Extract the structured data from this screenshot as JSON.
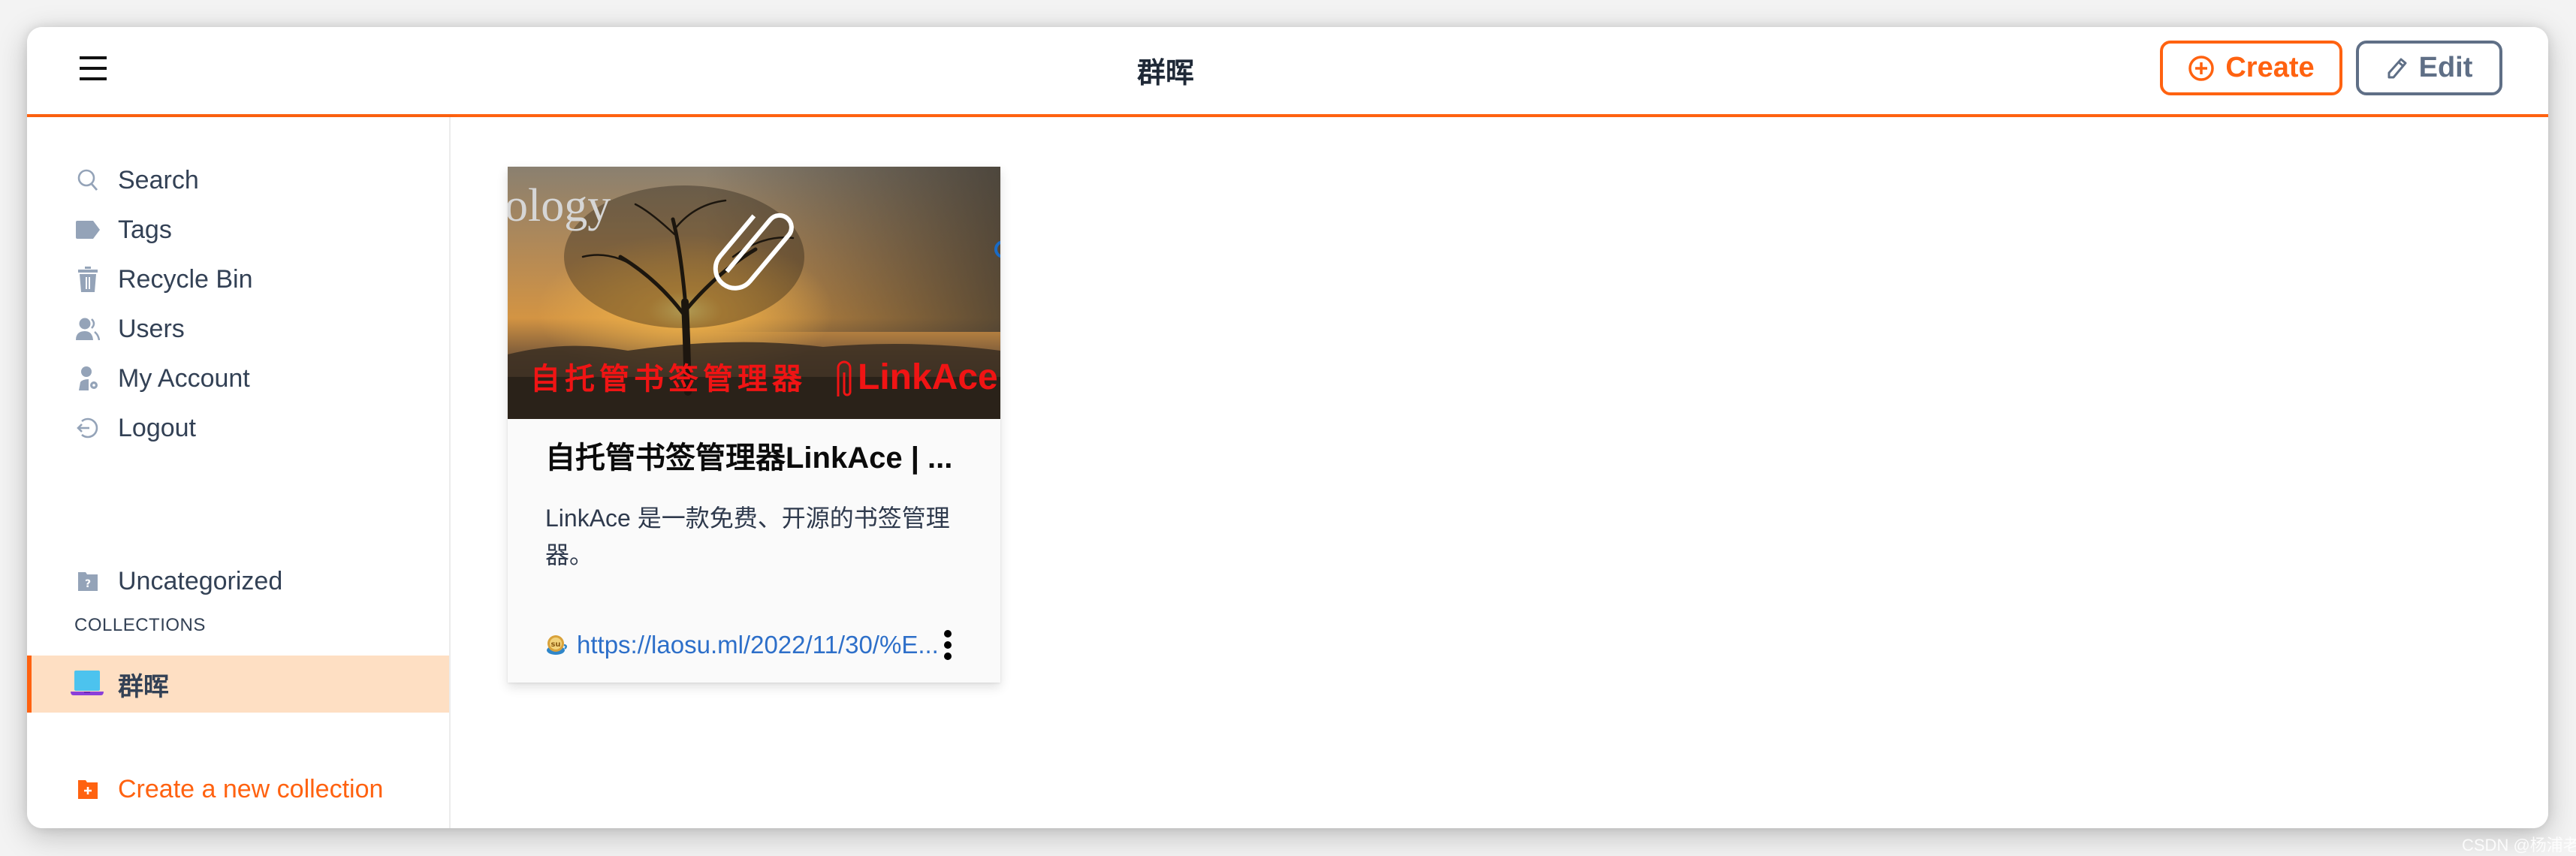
{
  "header": {
    "title": "群晖",
    "menu_icon": "hamburger-menu-icon",
    "create_label": "Create",
    "create_icon": "plus-circle-icon",
    "edit_label": "Edit",
    "edit_icon": "pencil-icon"
  },
  "sidebar": {
    "items": [
      {
        "label": "Search",
        "icon": "search-icon"
      },
      {
        "label": "Tags",
        "icon": "tag-icon"
      },
      {
        "label": "Recycle Bin",
        "icon": "trash-icon"
      },
      {
        "label": "Users",
        "icon": "users-icon"
      },
      {
        "label": "My Account",
        "icon": "user-gear-icon"
      },
      {
        "label": "Logout",
        "icon": "logout-icon"
      }
    ],
    "uncategorized": {
      "label": "Uncategorized",
      "icon": "folder-question-icon"
    },
    "collections_heading": "COLLECTIONS",
    "collections": [
      {
        "label": "群晖",
        "icon": "laptop-icon",
        "active": true
      }
    ],
    "create_collection": {
      "label": "Create a new collection",
      "icon": "folder-plus-icon"
    }
  },
  "main": {
    "links": [
      {
        "thumbnail": {
          "overlay_text": "自托管书签管理器",
          "overlay_brand": "LinkAce",
          "corner_text": "ology"
        },
        "title": "自托管书签管理器LinkAce | ...",
        "description": "LinkAce 是一款免费、开源的书签管理器。",
        "url": "https://laosu.ml/2022/11/30/%E...",
        "favicon": "stumbleupon-cup-icon",
        "menu_icon": "more-vertical-icon"
      }
    ]
  },
  "colors": {
    "accent": "#ff6210",
    "active_bg": "#fedfc3",
    "muted_icon": "#94a3b8",
    "text": "#334155",
    "link": "#2d6fc9",
    "edit_border": "#5f6f86"
  },
  "watermark": "CSDN @杨浦老苏"
}
